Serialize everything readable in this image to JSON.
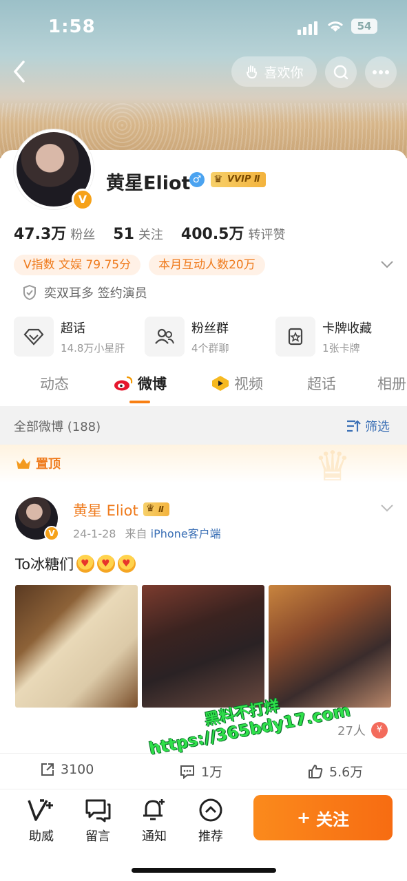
{
  "status_bar": {
    "time": "1:58",
    "battery": "54"
  },
  "header": {
    "like_label": "喜欢你",
    "icons": [
      "back-arrow-icon",
      "search-icon",
      "more-icon"
    ]
  },
  "profile": {
    "name": "黄星Eliot",
    "vip_label": "VVIP Ⅱ",
    "stats": [
      {
        "value": "47.3万",
        "label": "粉丝"
      },
      {
        "value": "51",
        "label": "关注"
      },
      {
        "value": "400.5万",
        "label": "转评赞"
      }
    ],
    "tags": [
      "V指数 文娱 79.75分",
      "本月互动人数20万"
    ],
    "certification": "奕双耳多 签约演员",
    "tiles": [
      {
        "title": "超话",
        "sub": "14.8万小星肝",
        "icon": "diamond-icon"
      },
      {
        "title": "粉丝群",
        "sub": "4个群聊",
        "icon": "group-icon"
      },
      {
        "title": "卡牌收藏",
        "sub": "1张卡牌",
        "icon": "card-icon"
      }
    ]
  },
  "tabs": [
    "动态",
    "微博",
    "视频",
    "超话",
    "相册"
  ],
  "active_tab": "微博",
  "filter": {
    "all_label": "全部微博 (188)",
    "filter_label": "筛选"
  },
  "pinned": {
    "label": "置顶"
  },
  "post": {
    "author": "黄星 Eliot",
    "vip_label": "Ⅱ",
    "date": "24-1-28",
    "from_prefix": "来自",
    "source": "iPhone客户端",
    "text": "To冰糖们",
    "reactors": "27人",
    "coin_label": "¥",
    "actions": {
      "repost": "3100",
      "comment": "1万",
      "like": "5.6万"
    }
  },
  "watermark": {
    "line1": "黑料不打烊",
    "line2": "https://365bdy17.com"
  },
  "bottom_bar": {
    "items": [
      {
        "label": "助威",
        "icon": "cheer-icon"
      },
      {
        "label": "留言",
        "icon": "message-icon"
      },
      {
        "label": "通知",
        "icon": "bell-icon"
      },
      {
        "label": "推荐",
        "icon": "recommend-icon"
      }
    ],
    "follow_label": "关注"
  },
  "colors": {
    "accent": "#f87f13",
    "link": "#3a6fb5",
    "vip_gold": "#f3b33d"
  }
}
